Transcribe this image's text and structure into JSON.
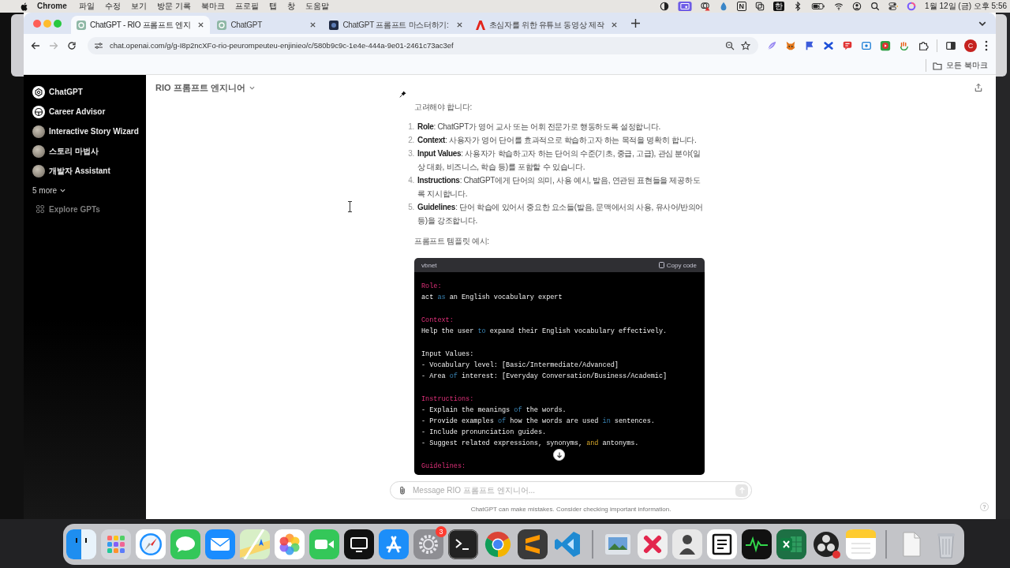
{
  "menu_bar": {
    "app_name": "Chrome",
    "menus": [
      "파일",
      "수정",
      "보기",
      "방문 기록",
      "북마크",
      "프로필",
      "탭",
      "창",
      "도움말"
    ],
    "status_badges": [
      "N",
      "한"
    ],
    "clock": "1월 12일 (금) 오후 5:56"
  },
  "browser": {
    "tabs": [
      {
        "title": "ChatGPT - RIO 프롬프트 엔지",
        "kind": "swirl",
        "selected": true
      },
      {
        "title": "ChatGPT",
        "kind": "swirl",
        "selected": false
      },
      {
        "title": "ChatGPT 프롬프트 마스터하기:",
        "kind": "tile",
        "selected": false
      },
      {
        "title": "초심자를 위한 유튜브 동영상 제작",
        "kind": "peak",
        "selected": false
      }
    ],
    "can_go_forward": false,
    "address": "chat.openai.com/g/g-I8p2ncXFo-rio-peurompeuteu-enjinieo/c/580b9c9c-1e4e-444a-9e01-2461c73ac3ef",
    "profile_initial": "C",
    "bookmarks_folder": "모든 북마크"
  },
  "sidebar": {
    "gpts": [
      {
        "name": "ChatGPT",
        "kind": "logo"
      },
      {
        "name": "Career Advisor",
        "kind": "symbol"
      },
      {
        "name": "Interactive Story Wizard",
        "kind": "picture"
      },
      {
        "name": "스토리 마법사",
        "kind": "picture"
      },
      {
        "name": "개발자 Assistant",
        "kind": "picture"
      }
    ],
    "more": "5 more",
    "explore": "Explore GPTs"
  },
  "chat": {
    "title": "RIO 프롬프트 엔지니어",
    "intro": "고려해야 합니다:",
    "items": [
      {
        "number": "1.",
        "text": "**Role**: ChatGPT가 영어 교사 또는 어휘 전문가로 행동하도록 설정합니다."
      },
      {
        "number": "2.",
        "text": "**Context**: 사용자가 영어 단어를 효과적으로 학습하고자 하는 목적을 명확히 합니다."
      },
      {
        "number": "3.",
        "text": "**Input Values**: 사용자가 학습하고자 하는 단어의 수준(기초, 중급, 고급), 관심 분야(일상 대화, 비즈니스, 학습 등)를 포함할 수 있습니다."
      },
      {
        "number": "4.",
        "text": "**Instructions**: ChatGPT에게 단어의 의미, 사용 예시, 발음, 연관된 표현들을 제공하도록 지시합니다."
      },
      {
        "number": "5.",
        "text": "**Guidelines**: 단어 학습에 있어서 중요한 요소들(발음, 문맥에서의 사용, 유사어/반의어 등)을 강조합니다."
      }
    ],
    "template_label": "프롬프트 템플릿 예시:",
    "code": {
      "language": "vbnet",
      "copy_label": "Copy code",
      "sections": [
        {
          "lines": [
            [
              {
                "text": "Role:",
                "kind": "label"
              }
            ],
            [
              {
                "text": "act ",
                "kind": "plain"
              },
              {
                "text": "as",
                "kind": "keyword"
              },
              {
                "text": " an English vocabulary expert",
                "kind": "plain"
              }
            ]
          ]
        },
        {
          "lines": [
            [
              {
                "text": "Context:",
                "kind": "label"
              }
            ],
            [
              {
                "text": "Help the user ",
                "kind": "plain"
              },
              {
                "text": "to",
                "kind": "keyword"
              },
              {
                "text": " expand their English vocabulary effectively.",
                "kind": "plain"
              }
            ]
          ]
        },
        {
          "lines": [
            [
              {
                "text": "Input Values:",
                "kind": "plain"
              }
            ],
            [
              {
                "text": "- Vocabulary level: [Basic/Intermediate/Advanced]",
                "kind": "plain"
              }
            ],
            [
              {
                "text": "- Area ",
                "kind": "plain"
              },
              {
                "text": "of",
                "kind": "keyword"
              },
              {
                "text": " interest: [Everyday Conversation/Business/Academic]",
                "kind": "plain"
              }
            ]
          ]
        },
        {
          "lines": [
            [
              {
                "text": "Instructions:",
                "kind": "label"
              }
            ],
            [
              {
                "text": "- Explain the meanings ",
                "kind": "plain"
              },
              {
                "text": "of",
                "kind": "keyword"
              },
              {
                "text": " the words.",
                "kind": "plain"
              }
            ],
            [
              {
                "text": "- Provide examples ",
                "kind": "plain"
              },
              {
                "text": "of",
                "kind": "keyword"
              },
              {
                "text": " how the words are used ",
                "kind": "plain"
              },
              {
                "text": "in",
                "kind": "keyword"
              },
              {
                "text": " sentences.",
                "kind": "plain"
              }
            ],
            [
              {
                "text": "- Include pronunciation guides.",
                "kind": "plain"
              }
            ],
            [
              {
                "text": "- Suggest related expressions, synonyms, ",
                "kind": "plain"
              },
              {
                "text": "and",
                "kind": "operator"
              },
              {
                "text": " antonyms.",
                "kind": "plain"
              }
            ]
          ]
        },
        {
          "lines": [
            [
              {
                "text": "Guidelines:",
                "kind": "label"
              }
            ]
          ]
        }
      ]
    }
  },
  "composer": {
    "placeholder": "Message RIO 프롬프트 엔지니어...",
    "disclaimer": "ChatGPT can make mistakes. Consider checking important information.",
    "help": "?"
  },
  "dock": {
    "badge": "3"
  }
}
